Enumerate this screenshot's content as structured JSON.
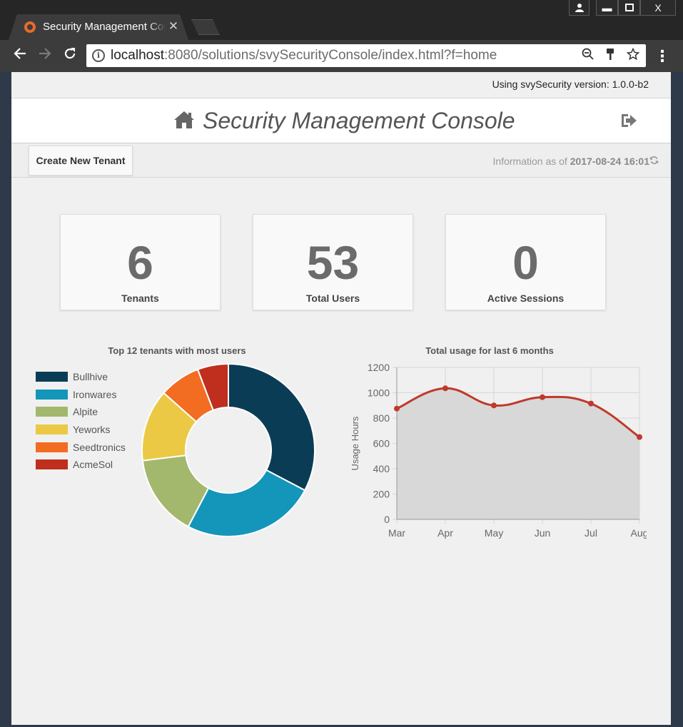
{
  "browser": {
    "tab_title": "Security Management Console",
    "url_prefix": "localhost",
    "url_rest": ":8080/solutions/svySecurityConsole/index.html?f=home",
    "window_buttons": {
      "user": "user-icon",
      "minimize": "–",
      "maximize": "□",
      "close": "X"
    }
  },
  "page": {
    "version_text": "Using svySecurity version: 1.0.0-b2",
    "title": "Security Management Console",
    "create_tenant_label": "Create New Tenant",
    "info_prefix": "Information as of ",
    "info_timestamp": "2017-08-24 16:01",
    "stats": [
      {
        "value": "6",
        "label": "Tenants"
      },
      {
        "value": "53",
        "label": "Total Users"
      },
      {
        "value": "0",
        "label": "Active Sessions"
      }
    ]
  },
  "chart_data": [
    {
      "type": "pie",
      "variant": "doughnut",
      "title": "Top 12 tenants with most users",
      "legend_position": "left",
      "categories": [
        "Bullhive",
        "Ironwares",
        "Alpite",
        "Yeworks",
        "Seedtronics",
        "AcmeSol"
      ],
      "values": [
        17,
        13,
        8,
        7,
        4,
        3
      ],
      "colors": [
        "#0b3c55",
        "#1496bb",
        "#a3b86c",
        "#ebc944",
        "#f26d21",
        "#c02e1d"
      ]
    },
    {
      "type": "area",
      "title": "Total usage for last 6 months",
      "xlabel": "",
      "ylabel": "Usage Hours",
      "categories": [
        "Mar",
        "Apr",
        "May",
        "Jun",
        "Jul",
        "Aug"
      ],
      "values": [
        875,
        1035,
        900,
        965,
        915,
        650
      ],
      "ylim": [
        0,
        1200
      ],
      "yticks": [
        0,
        200,
        400,
        600,
        800,
        1000,
        1200
      ],
      "grid": true,
      "line_color": "#c0392b",
      "fill_color": "#d8d8d8"
    }
  ]
}
